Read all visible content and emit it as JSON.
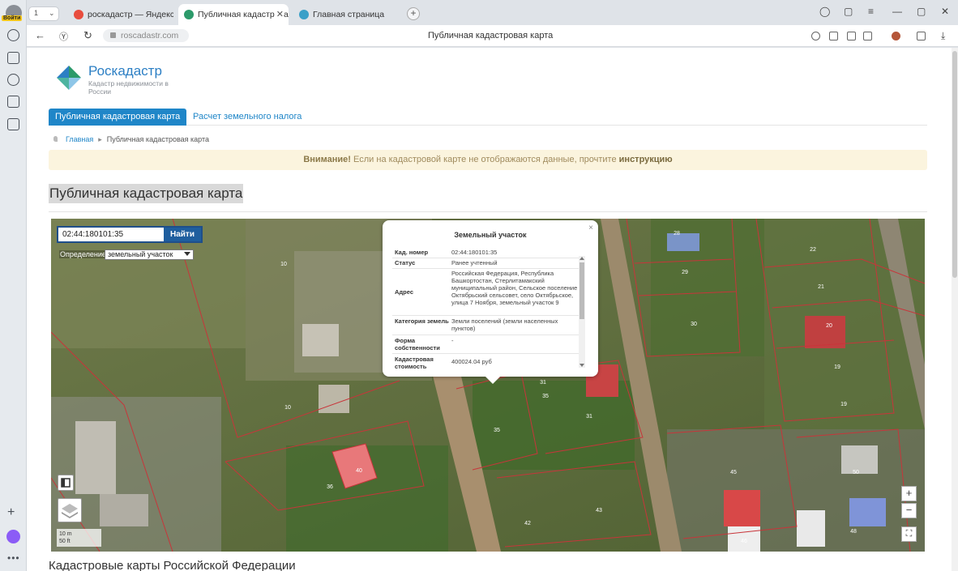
{
  "browser": {
    "login_label": "Войти",
    "tabs": [
      {
        "label": "роскадастр — Яндекс: нашлось",
        "favicon_color": "#e84c3d"
      },
      {
        "label": "Публичная кадастровая карта",
        "favicon_color": "#2c9a6a"
      },
      {
        "label": "Главная страница",
        "favicon_color": "#3aa0c8"
      }
    ],
    "tab_switch": "1",
    "url": "roscadastr.com",
    "page_title": "Публичная кадастровая карта"
  },
  "site": {
    "logo_name": "Роскадастр",
    "logo_sub": "Кадастр недвижимости в России",
    "nav": {
      "active": "Публичная кадастровая карта",
      "other": "Расчет земельного налога"
    },
    "breadcrumb": {
      "home": "Главная",
      "current": "Публичная кадастровая карта"
    },
    "alert": {
      "bold": "Внимание!",
      "text": "Если на кадастровой карте не отображаются данные, прочтите",
      "link": "инструкцию"
    },
    "heading": "Публичная кадастровая карта",
    "subheading": "Кадастровые карты Российской Федерации"
  },
  "map": {
    "search_value": "02:44:180101:35",
    "search_button": "Найти",
    "definition_label": "Определение:",
    "definition_value": "земельный участок",
    "scale": [
      "10 m",
      "50 ft"
    ],
    "zoom_in": "+",
    "zoom_out": "−",
    "parcel_numbers": [
      "10",
      "10",
      "28",
      "29",
      "30",
      "22",
      "21",
      "20",
      "19",
      "19",
      "31",
      "35",
      "31",
      "35",
      "40",
      "36",
      "42",
      "43",
      "45",
      "50",
      "46",
      "48"
    ],
    "popup": {
      "title": "Земельный участок",
      "close": "×",
      "rows": [
        {
          "key": "Кад. номер",
          "value": "02:44:180101:35"
        },
        {
          "key": "Статус",
          "value": "Ранее учтенный"
        },
        {
          "key": "Адрес",
          "value": "Российская Федерация, Республика Башкортостан, Стерлитамакский муниципальный район, Сельское поселение Октябрьский сельсовет, село Октябрьское, улица 7 Ноября, земельный участок 9"
        },
        {
          "key": "Категория земель",
          "value": "Земли поселений (земли населенных пунктов)"
        },
        {
          "key": "Форма собственности",
          "value": "-"
        },
        {
          "key": "Кадастровая стоимость",
          "value": "400024.04 руб"
        }
      ]
    }
  },
  "colors": {
    "brand_blue": "#1f86c8",
    "alert_bg": "#fbf4de",
    "parcel_line": "#c8353a",
    "highlight_parcel": "#e8787a"
  }
}
